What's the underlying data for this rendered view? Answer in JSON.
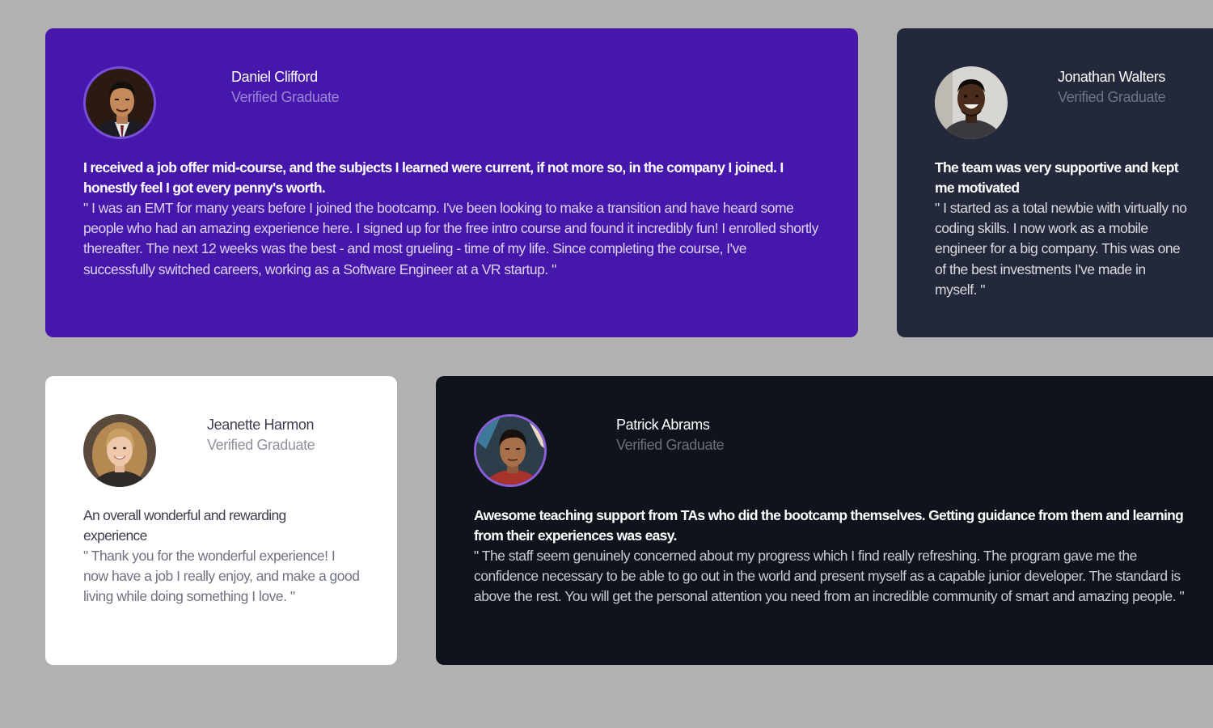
{
  "colors": {
    "page_background": "#b1b1b1",
    "card_purple": "#4617ab",
    "card_slate": "#23283a",
    "card_white": "#ffffff",
    "card_black": "#0f141c"
  },
  "testimonials": [
    {
      "name": "Daniel Clifford",
      "role": "Verified Graduate",
      "headline": "I received a job offer mid-course, and the subjects I learned were current, if not more so, in the company I joined. I honestly feel I got every penny's worth.",
      "quote": "\" I was an EMT for many years before I joined the bootcamp. I've been looking to make a transition and have heard some people who had an amazing experience here. I signed up for the free intro course and found it incredibly fun! I enrolled shortly thereafter. The next 12 weeks was the best - and most grueling - time of my life. Since completing the course, I've successfully switched careers, working as a Software Engineer at a VR startup. \"",
      "avatar_icon": "avatar-photo-daniel"
    },
    {
      "name": "Jonathan Walters",
      "role": "Verified Graduate",
      "headline": "The team was very supportive and kept me motivated",
      "quote": "\" I started as a total newbie with virtually no coding skills. I now work as a mobile engineer for a big company. This was one of the best investments I've made in myself. \"",
      "avatar_icon": "avatar-photo-jonathan"
    },
    {
      "name": "Jeanette Harmon",
      "role": "Verified Graduate",
      "headline": "An overall wonderful and rewarding experience",
      "quote": "\" Thank you for the wonderful experience! I now have a job I really enjoy, and make a good living while doing something I love. \"",
      "avatar_icon": "avatar-photo-jeanette"
    },
    {
      "name": "Patrick Abrams",
      "role": "Verified Graduate",
      "headline": "Awesome teaching support from TAs who did the bootcamp themselves. Getting guidance from them and learning from their experiences was easy.",
      "quote": "\" The staff seem genuinely concerned about my progress which I find really refreshing. The program gave me the confidence necessary to be able to go out in the world and present myself as a capable junior developer. The standard is above the rest. You will get the personal attention you need from an incredible community of smart and amazing people. \"",
      "avatar_icon": "avatar-photo-patrick"
    }
  ]
}
